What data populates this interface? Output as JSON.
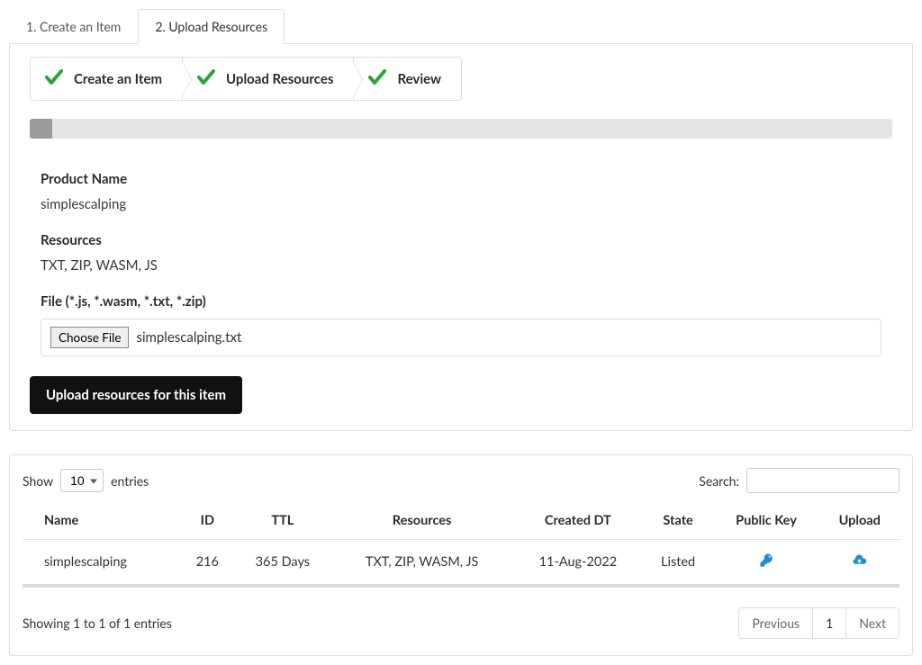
{
  "tabs": {
    "items": [
      {
        "label": "1. Create an Item",
        "active": false
      },
      {
        "label": "2. Upload Resources",
        "active": true
      }
    ]
  },
  "wizard": {
    "steps": [
      {
        "label": "Create an Item"
      },
      {
        "label": "Upload Resources"
      },
      {
        "label": "Review"
      }
    ]
  },
  "form": {
    "product_name_label": "Product Name",
    "product_name_value": "simplescalping",
    "resources_label": "Resources",
    "resources_value": "TXT, ZIP, WASM, JS",
    "file_label": "File (*.js, *.wasm, *.txt, *.zip)",
    "choose_file_label": "Choose File",
    "chosen_file_name": "simplescalping.txt",
    "upload_button_label": "Upload resources for this item"
  },
  "table": {
    "show_prefix": "Show",
    "show_suffix": "entries",
    "entries_value": "10",
    "search_label": "Search:",
    "columns": {
      "name": "Name",
      "id": "ID",
      "ttl": "TTL",
      "resources": "Resources",
      "created": "Created DT",
      "state": "State",
      "pubkey": "Public Key",
      "upload": "Upload"
    },
    "rows": [
      {
        "name": "simplescalping",
        "id": "216",
        "ttl": "365 Days",
        "resources": "TXT, ZIP, WASM, JS",
        "created": "11-Aug-2022",
        "state": "Listed"
      }
    ],
    "info_text": "Showing 1 to 1 of 1 entries",
    "pager": {
      "previous": "Previous",
      "current": "1",
      "next": "Next"
    }
  }
}
